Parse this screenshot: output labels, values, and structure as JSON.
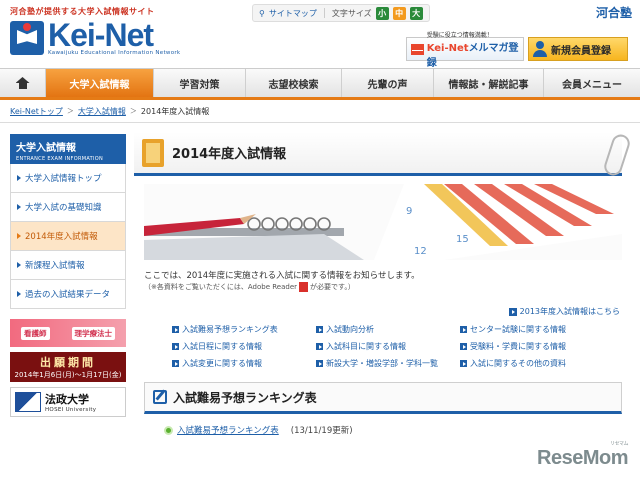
{
  "header": {
    "tagline": "河合塾が提供する大学入試情報サイト",
    "logo_name": "Kei-Net",
    "logo_sub": "Kawaijuku Educational Information Network",
    "sitemap_label": "サイトマップ",
    "font_size_label": "文字サイズ",
    "font_sizes": [
      "小",
      "中",
      "大"
    ],
    "brand": "河合塾",
    "mail_banner_small": "受験に役立つ情報満載！",
    "mail_banner_brand": "Kei-Net",
    "mail_banner_big": "メルマガ登録",
    "member_banner": "新規会員登録"
  },
  "nav": {
    "items": [
      "大学入試情報",
      "学習対策",
      "志望校検索",
      "先輩の声",
      "情報誌・解説記事",
      "会員メニュー"
    ]
  },
  "breadcrumb": {
    "items": [
      "Kei-Netトップ",
      "大学入試情報",
      "2014年度入試情報"
    ]
  },
  "sidebar": {
    "head_title": "大学入試情報",
    "head_sub": "ENTRANCE EXAM INFORMATION",
    "items": [
      "大学入試情報トップ",
      "大学入試の基礎知識",
      "2014年度入試情報",
      "新課程入試情報",
      "過去の入試結果データ"
    ],
    "banner1_left": "看護師",
    "banner1_right": "理学療法士",
    "banner2_title": "出願期間",
    "banner2_dates": "2014年1月6日(月)〜1月17日(金)",
    "banner3_title": "法政大学",
    "banner3_sub": "HOSEI University"
  },
  "main": {
    "page_title": "2014年度入試情報",
    "intro": "ここでは、2014年度に実施される入試に関する情報をお知らせします。",
    "note_prefix": "（※各資料をご覧いただくには、Adobe Reader",
    "note_suffix": "が必要です。）",
    "prev_link": "2013年度入試情報はこちら",
    "grid_links": [
      "入試難易予想ランキング表",
      "入試動向分析",
      "センター試験に関する情報",
      "入試日程に関する情報",
      "入試科目に関する情報",
      "受験料・学費に関する情報",
      "入試変更に関する情報",
      "新設大学・増設学部・学科一覧",
      "入試に関するその他の資料"
    ],
    "section_title": "入試難易予想ランキング表",
    "ranking_link": "入試難易予想ランキング表",
    "ranking_date": "(13/11/19更新)"
  },
  "watermark": {
    "main": "ReseMom",
    "sub": "リセマム"
  },
  "colors": {
    "brand_blue": "#1e5fa8",
    "accent_orange": "#e57b16"
  }
}
